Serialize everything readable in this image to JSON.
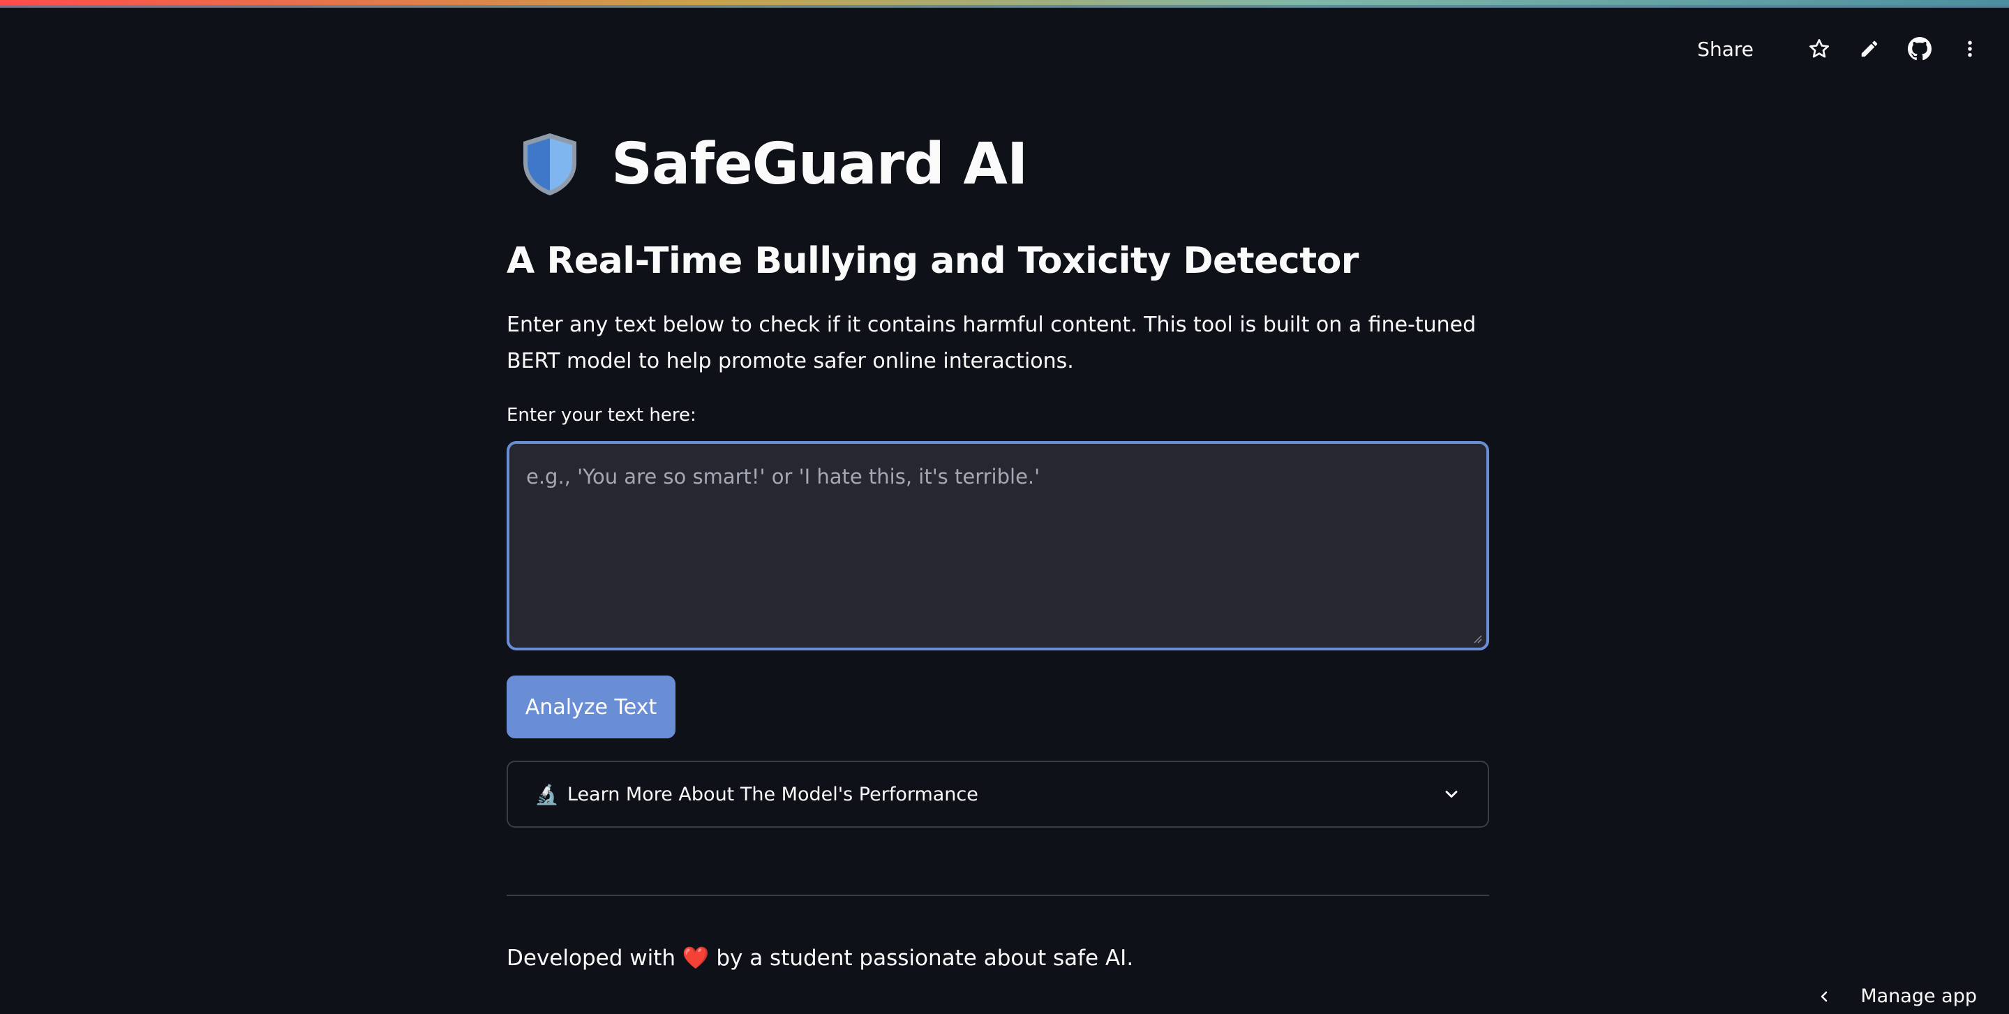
{
  "toolbar": {
    "share_label": "Share",
    "icons": [
      "star-icon",
      "pencil-icon",
      "github-icon",
      "more-vertical-icon"
    ]
  },
  "app": {
    "icon": "shield-icon",
    "title": "SafeGuard AI",
    "subtitle": "A Real-Time Bullying and Toxicity Detector",
    "description": "Enter any text below to check if it contains harmful content. This tool is built on a fine-tuned BERT model to help promote safer online interactions."
  },
  "input": {
    "label": "Enter your text here:",
    "value": "",
    "placeholder": "e.g., 'You are so smart!' or 'I hate this, it's terrible.'"
  },
  "actions": {
    "analyze_label": "Analyze Text"
  },
  "expander": {
    "icon": "🔬",
    "label": "Learn More About The Model's Performance"
  },
  "footer": {
    "before": "Developed with",
    "heart": "❤️",
    "after": "by a student passionate about safe AI."
  },
  "manage": {
    "label": "Manage app"
  },
  "colors": {
    "background": "#0e1117",
    "accent": "#6a8ed6",
    "input_bg": "#262730"
  }
}
